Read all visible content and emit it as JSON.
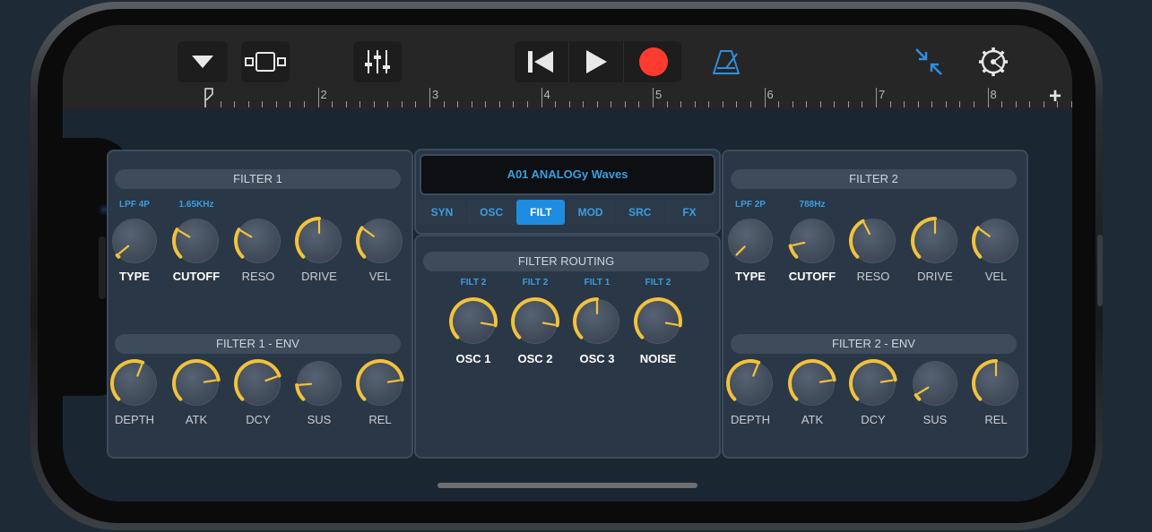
{
  "toolbar": {
    "buttons": [
      "browser-dropdown",
      "tracks-view",
      "mixer",
      "go-to-start",
      "play",
      "record",
      "metronome",
      "collapse",
      "settings"
    ]
  },
  "ruler": {
    "bars": [
      "2",
      "3",
      "4",
      "5",
      "6",
      "7",
      "8"
    ],
    "add_label": "+"
  },
  "preset": {
    "name": "A01 ANALOGy Waves"
  },
  "tabs": [
    {
      "label": "SYN",
      "active": false
    },
    {
      "label": "OSC",
      "active": false
    },
    {
      "label": "FILT",
      "active": true
    },
    {
      "label": "MOD",
      "active": false
    },
    {
      "label": "SRC",
      "active": false
    },
    {
      "label": "FX",
      "active": false
    }
  ],
  "filter1": {
    "title": "FILTER 1",
    "type_value": "LPF 4P",
    "cutoff_value": "1.65KHz",
    "knobs": [
      {
        "label": "TYPE",
        "value": 0.02,
        "bold": true
      },
      {
        "label": "CUTOFF",
        "value": 0.28,
        "bold": true
      },
      {
        "label": "RESO",
        "value": 0.28,
        "bold": false
      },
      {
        "label": "DRIVE",
        "value": 0.5,
        "bold": false
      },
      {
        "label": "VEL",
        "value": 0.3,
        "bold": false
      }
    ]
  },
  "filter1_env": {
    "title": "FILTER 1 - ENV",
    "knobs": [
      {
        "label": "DEPTH",
        "value": 0.58
      },
      {
        "label": "ATK",
        "value": 0.8
      },
      {
        "label": "DCY",
        "value": 0.76
      },
      {
        "label": "SUS",
        "value": 0.15
      },
      {
        "label": "REL",
        "value": 0.8
      }
    ]
  },
  "filter2": {
    "title": "FILTER 2",
    "type_value": "LPF 2P",
    "cutoff_value": "788Hz",
    "knobs": [
      {
        "label": "TYPE",
        "value": 0.0,
        "bold": true
      },
      {
        "label": "CUTOFF",
        "value": 0.12,
        "bold": true
      },
      {
        "label": "RESO",
        "value": 0.4,
        "bold": false
      },
      {
        "label": "DRIVE",
        "value": 0.5,
        "bold": false
      },
      {
        "label": "VEL",
        "value": 0.3,
        "bold": false
      }
    ]
  },
  "filter2_env": {
    "title": "FILTER 2 - ENV",
    "knobs": [
      {
        "label": "DEPTH",
        "value": 0.58
      },
      {
        "label": "ATK",
        "value": 0.8
      },
      {
        "label": "DCY",
        "value": 0.8
      },
      {
        "label": "SUS",
        "value": 0.05
      },
      {
        "label": "REL",
        "value": 0.5
      }
    ]
  },
  "routing": {
    "title": "FILTER ROUTING",
    "knobs": [
      {
        "label": "OSC 1",
        "route": "FILT 2",
        "value": 0.87
      },
      {
        "label": "OSC 2",
        "route": "FILT 2",
        "value": 0.87
      },
      {
        "label": "OSC 3",
        "route": "FILT 1",
        "value": 0.5
      },
      {
        "label": "NOISE",
        "route": "FILT 2",
        "value": 0.87
      }
    ]
  },
  "colors": {
    "accent": "#f2c23c",
    "blue": "#3a9ee0",
    "record": "#ff3b30",
    "panel": "#2a3746"
  }
}
